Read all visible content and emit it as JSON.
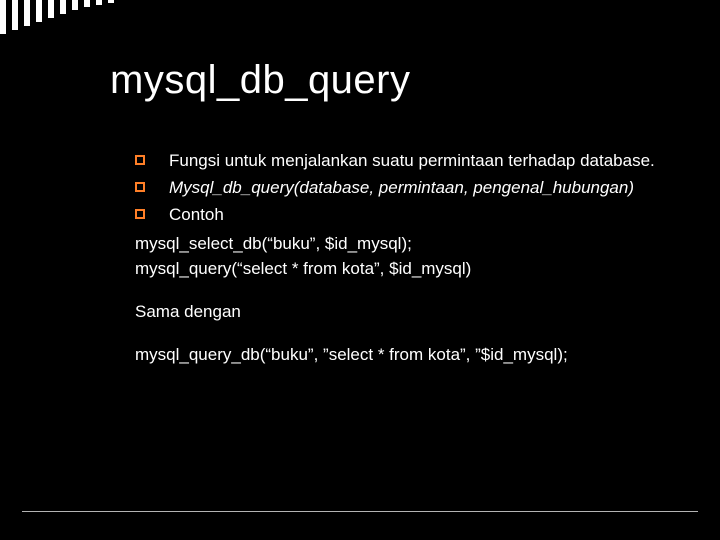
{
  "title": "mysql_db_query",
  "bullets": [
    {
      "text": "Fungsi untuk menjalankan suatu permintaan terhadap database.",
      "italic": false
    },
    {
      "text": "Mysql_db_query(database, permintaan, pengenal_hubungan)",
      "italic": true
    },
    {
      "text": "Contoh",
      "italic": false
    }
  ],
  "body": [
    "mysql_select_db(“buku”, $id_mysql);",
    "mysql_query(“select * from kota”, $id_mysql)",
    "",
    "Sama dengan",
    "",
    "mysql_query_db(“buku”, ”select * from kota”, ”$id_mysql);"
  ]
}
